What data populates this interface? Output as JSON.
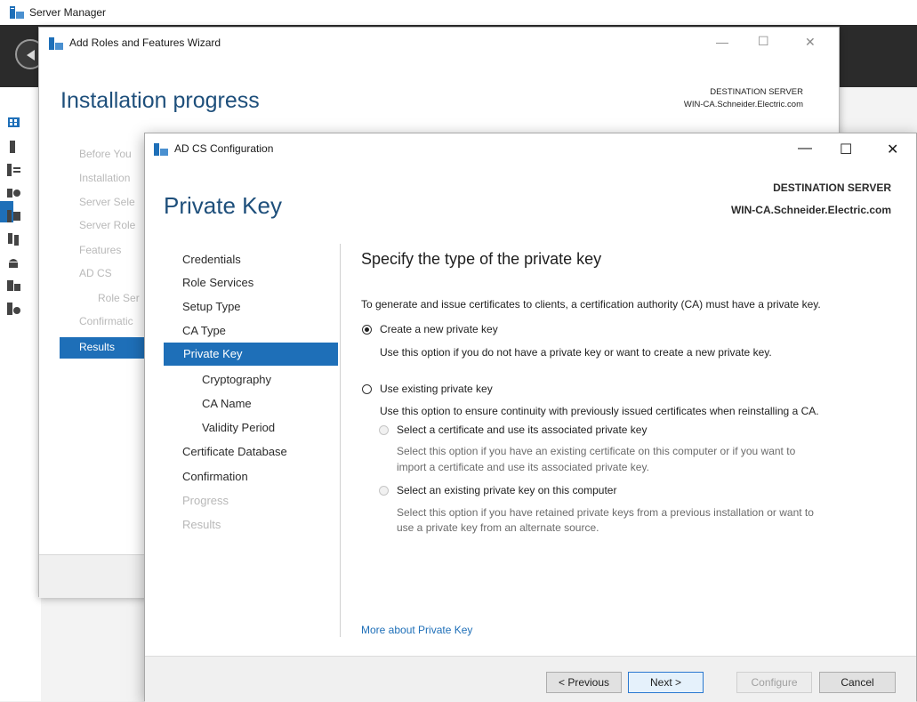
{
  "server_manager": {
    "title": "Server Manager"
  },
  "wizard": {
    "title": "Add Roles and Features Wizard",
    "heading": "Installation progress",
    "destination_label": "DESTINATION SERVER",
    "destination_server": "WIN-CA.Schneider.Electric.com",
    "nav": [
      {
        "label": "Before You"
      },
      {
        "label": "Installation"
      },
      {
        "label": "Server Sele"
      },
      {
        "label": "Server Role"
      },
      {
        "label": "Features"
      },
      {
        "label": "AD CS"
      },
      {
        "label": "Role Ser"
      },
      {
        "label": "Confirmatic"
      },
      {
        "label": "Results"
      }
    ],
    "caption": {
      "minimize": "—",
      "maximize": "☐",
      "close": "✕"
    }
  },
  "dialog": {
    "title": "AD CS Configuration",
    "heading": "Private Key",
    "destination_label": "DESTINATION SERVER",
    "destination_server": "WIN-CA.Schneider.Electric.com",
    "caption": {
      "minimize": "—",
      "maximize": "☐",
      "close": "✕"
    },
    "nav": [
      {
        "label": "Credentials"
      },
      {
        "label": "Role Services"
      },
      {
        "label": "Setup Type"
      },
      {
        "label": "CA Type"
      },
      {
        "label": "Private Key"
      },
      {
        "label": "Cryptography"
      },
      {
        "label": "CA Name"
      },
      {
        "label": "Validity Period"
      },
      {
        "label": "Certificate Database"
      },
      {
        "label": "Confirmation"
      },
      {
        "label": "Progress"
      },
      {
        "label": "Results"
      }
    ],
    "content": {
      "heading": "Specify the type of the private key",
      "intro": "To generate and issue certificates to clients, a certification authority (CA) must have a private key.",
      "option_new": {
        "label": "Create a new private key",
        "desc": "Use this option if you do not have a private key or want to create a new private key.",
        "selected": true
      },
      "option_existing": {
        "label": "Use existing private key",
        "desc": "Use this option to ensure continuity with previously issued certificates when reinstalling a CA.",
        "selected": false
      },
      "sub_cert": {
        "label": "Select a certificate and use its associated private key",
        "desc_line1": "Select this option if you have an existing certificate on this computer or if you want to",
        "desc_line2": "import a certificate and use its associated private key."
      },
      "sub_key": {
        "label": "Select an existing private key on this computer",
        "desc_line1": "Select this option if you have retained private keys from a previous installation or want to",
        "desc_line2": "use a private key from an alternate source."
      },
      "more_link": "More about Private Key"
    },
    "buttons": {
      "previous": "< Previous",
      "next": "Next >",
      "configure": "Configure",
      "cancel": "Cancel"
    }
  },
  "colors": {
    "accent": "#1e6fb8",
    "heading": "#1e4f7b"
  }
}
